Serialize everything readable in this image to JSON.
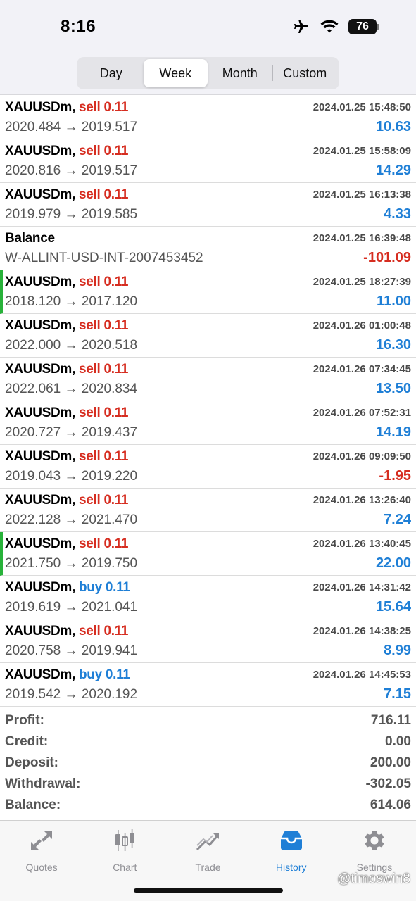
{
  "status_bar": {
    "time": "8:16",
    "battery": "76",
    "icons": [
      "airplane-icon",
      "wifi-icon",
      "battery-icon"
    ]
  },
  "period_tabs": [
    {
      "label": "Day",
      "active": false
    },
    {
      "label": "Week",
      "active": true
    },
    {
      "label": "Month",
      "active": false
    },
    {
      "label": "Custom",
      "active": false
    }
  ],
  "deals": [
    {
      "symbol": "XAUUSDm,",
      "side": "sell 0.11",
      "type": "sell",
      "datetime": "2024.01.25 15:48:50",
      "prices": "2020.484 → 2019.517",
      "profit": "10.63",
      "marked": false
    },
    {
      "symbol": "XAUUSDm,",
      "side": "sell 0.11",
      "type": "sell",
      "datetime": "2024.01.25 15:58:09",
      "prices": "2020.816 → 2019.517",
      "profit": "14.29",
      "marked": false
    },
    {
      "symbol": "XAUUSDm,",
      "side": "sell 0.11",
      "type": "sell",
      "datetime": "2024.01.25 16:13:38",
      "prices": "2019.979 → 2019.585",
      "profit": "4.33",
      "marked": false
    },
    {
      "symbol": "Balance",
      "side": "",
      "type": "balance",
      "datetime": "2024.01.25 16:39:48",
      "prices": "W-ALLINT-USD-INT-2007453452",
      "profit": "-101.09",
      "marked": false
    },
    {
      "symbol": "XAUUSDm,",
      "side": "sell 0.11",
      "type": "sell",
      "datetime": "2024.01.25 18:27:39",
      "prices": "2018.120 → 2017.120",
      "profit": "11.00",
      "marked": true
    },
    {
      "symbol": "XAUUSDm,",
      "side": "sell 0.11",
      "type": "sell",
      "datetime": "2024.01.26 01:00:48",
      "prices": "2022.000 → 2020.518",
      "profit": "16.30",
      "marked": false
    },
    {
      "symbol": "XAUUSDm,",
      "side": "sell 0.11",
      "type": "sell",
      "datetime": "2024.01.26 07:34:45",
      "prices": "2022.061 → 2020.834",
      "profit": "13.50",
      "marked": false
    },
    {
      "symbol": "XAUUSDm,",
      "side": "sell 0.11",
      "type": "sell",
      "datetime": "2024.01.26 07:52:31",
      "prices": "2020.727 → 2019.437",
      "profit": "14.19",
      "marked": false
    },
    {
      "symbol": "XAUUSDm,",
      "side": "sell 0.11",
      "type": "sell",
      "datetime": "2024.01.26 09:09:50",
      "prices": "2019.043 → 2019.220",
      "profit": "-1.95",
      "marked": false
    },
    {
      "symbol": "XAUUSDm,",
      "side": "sell 0.11",
      "type": "sell",
      "datetime": "2024.01.26 13:26:40",
      "prices": "2022.128 → 2021.470",
      "profit": "7.24",
      "marked": false
    },
    {
      "symbol": "XAUUSDm,",
      "side": "sell 0.11",
      "type": "sell",
      "datetime": "2024.01.26 13:40:45",
      "prices": "2021.750 → 2019.750",
      "profit": "22.00",
      "marked": true
    },
    {
      "symbol": "XAUUSDm,",
      "side": "buy 0.11",
      "type": "buy",
      "datetime": "2024.01.26 14:31:42",
      "prices": "2019.619 → 2021.041",
      "profit": "15.64",
      "marked": false
    },
    {
      "symbol": "XAUUSDm,",
      "side": "sell 0.11",
      "type": "sell",
      "datetime": "2024.01.26 14:38:25",
      "prices": "2020.758 → 2019.941",
      "profit": "8.99",
      "marked": false
    },
    {
      "symbol": "XAUUSDm,",
      "side": "buy 0.11",
      "type": "buy",
      "datetime": "2024.01.26 14:45:53",
      "prices": "2019.542 → 2020.192",
      "profit": "7.15",
      "marked": false
    }
  ],
  "summary": [
    {
      "label": "Profit:",
      "value": "716.11"
    },
    {
      "label": "Credit:",
      "value": "0.00"
    },
    {
      "label": "Deposit:",
      "value": "200.00"
    },
    {
      "label": "Withdrawal:",
      "value": "-302.05"
    },
    {
      "label": "Balance:",
      "value": "614.06"
    }
  ],
  "tab_bar": [
    {
      "label": "Quotes",
      "icon": "quotes-icon",
      "active": false
    },
    {
      "label": "Chart",
      "icon": "chart-icon",
      "active": false
    },
    {
      "label": "Trade",
      "icon": "trade-icon",
      "active": false
    },
    {
      "label": "History",
      "icon": "history-icon",
      "active": true
    },
    {
      "label": "Settings",
      "icon": "gear-icon",
      "active": false
    }
  ],
  "watermark": "@timoswin8",
  "colors": {
    "sell": "#d62d20",
    "buy": "#1f7fd6",
    "profit_positive": "#1f7fd6",
    "profit_negative": "#d62d20",
    "marker": "#28b23a",
    "active_tab": "#1f7fd6"
  }
}
